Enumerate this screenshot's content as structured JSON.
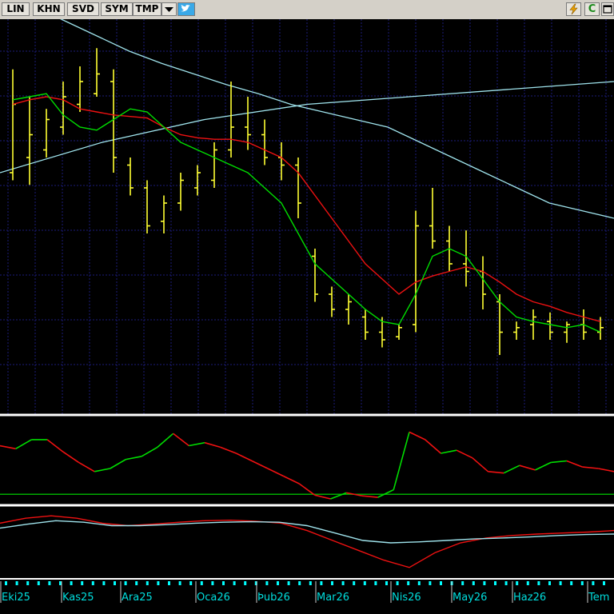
{
  "toolbar": {
    "buttons": [
      "LIN",
      "KHN",
      "SVD",
      "SYM",
      "TMP"
    ],
    "icons": [
      "dropdown-arrow-icon",
      "twitter-bird-icon",
      "lightning-icon",
      "refresh-c-icon",
      "maximize-icon"
    ],
    "refresh_label": "C"
  },
  "colors": {
    "background": "#000000",
    "grid": "#1b1b7a",
    "price_bar": "#ffff33",
    "ma_fast": "#00dd00",
    "ma_slow": "#ee1111",
    "ma_long": "#9fe3ec",
    "panel_border": "#ffffff",
    "level_line": "#00aa00",
    "axis_tick": "#00ffff",
    "axis_text": "#00dddd"
  },
  "chart_data": {
    "type": "line",
    "x_labels": [
      "Eki25",
      "Kas25",
      "Ara25",
      "Oca26",
      "Þub26",
      "Mar26",
      "Nis26",
      "May26",
      "Haz26",
      "Tem"
    ],
    "price_bars": [
      {
        "hi": 4.78,
        "lo": 4.05,
        "open": 4.1,
        "close": 4.55
      },
      {
        "hi": 4.6,
        "lo": 4.02,
        "open": 4.2,
        "close": 4.35
      },
      {
        "hi": 4.52,
        "lo": 4.2,
        "open": 4.25,
        "close": 4.45
      },
      {
        "hi": 4.7,
        "lo": 4.35,
        "open": 4.4,
        "close": 4.6
      },
      {
        "hi": 4.8,
        "lo": 4.5,
        "open": 4.55,
        "close": 4.7
      },
      {
        "hi": 4.92,
        "lo": 4.6,
        "open": 4.62,
        "close": 4.75
      },
      {
        "hi": 4.78,
        "lo": 4.1,
        "open": 4.7,
        "close": 4.2
      },
      {
        "hi": 4.2,
        "lo": 3.95,
        "open": 4.15,
        "close": 4.0
      },
      {
        "hi": 4.05,
        "lo": 3.7,
        "open": 4.0,
        "close": 3.75
      },
      {
        "hi": 3.95,
        "lo": 3.7,
        "open": 3.78,
        "close": 3.9
      },
      {
        "hi": 4.1,
        "lo": 3.85,
        "open": 3.9,
        "close": 4.05
      },
      {
        "hi": 4.15,
        "lo": 3.95,
        "open": 4.0,
        "close": 4.1
      },
      {
        "hi": 4.3,
        "lo": 4.0,
        "open": 4.05,
        "close": 4.25
      },
      {
        "hi": 4.7,
        "lo": 4.2,
        "open": 4.25,
        "close": 4.4
      },
      {
        "hi": 4.6,
        "lo": 4.25,
        "open": 4.4,
        "close": 4.35
      },
      {
        "hi": 4.45,
        "lo": 4.15,
        "open": 4.35,
        "close": 4.2
      },
      {
        "hi": 4.3,
        "lo": 4.05,
        "open": 4.2,
        "close": 4.15
      },
      {
        "hi": 4.2,
        "lo": 3.8,
        "open": 4.15,
        "close": 3.9
      },
      {
        "hi": 3.6,
        "lo": 3.25,
        "open": 3.55,
        "close": 3.3
      },
      {
        "hi": 3.35,
        "lo": 3.15,
        "open": 3.3,
        "close": 3.2
      },
      {
        "hi": 3.3,
        "lo": 3.1,
        "open": 3.2,
        "close": 3.25
      },
      {
        "hi": 3.2,
        "lo": 3.0,
        "open": 3.15,
        "close": 3.05
      },
      {
        "hi": 3.15,
        "lo": 2.95,
        "open": 3.05,
        "close": 3.0
      },
      {
        "hi": 3.1,
        "lo": 3.0,
        "open": 3.02,
        "close": 3.08
      },
      {
        "hi": 3.85,
        "lo": 3.05,
        "open": 3.1,
        "close": 3.75
      },
      {
        "hi": 4.0,
        "lo": 3.6,
        "open": 3.75,
        "close": 3.65
      },
      {
        "hi": 3.75,
        "lo": 3.45,
        "open": 3.65,
        "close": 3.5
      },
      {
        "hi": 3.72,
        "lo": 3.35,
        "open": 3.5,
        "close": 3.45
      },
      {
        "hi": 3.55,
        "lo": 3.2,
        "open": 3.45,
        "close": 3.3
      },
      {
        "hi": 3.3,
        "lo": 2.9,
        "open": 3.25,
        "close": 3.05
      },
      {
        "hi": 3.12,
        "lo": 3.0,
        "open": 3.05,
        "close": 3.08
      },
      {
        "hi": 3.2,
        "lo": 3.0,
        "open": 3.1,
        "close": 3.15
      },
      {
        "hi": 3.18,
        "lo": 3.0,
        "open": 3.12,
        "close": 3.05
      },
      {
        "hi": 3.12,
        "lo": 2.98,
        "open": 3.05,
        "close": 3.1
      },
      {
        "hi": 3.2,
        "lo": 3.0,
        "open": 3.1,
        "close": 3.05
      },
      {
        "hi": 3.15,
        "lo": 3.0,
        "open": 3.05,
        "close": 3.08
      }
    ],
    "series": [
      {
        "values": [
          4.58,
          4.6,
          4.62,
          4.48,
          4.4,
          4.38,
          4.45,
          4.52,
          4.5,
          4.4,
          4.3,
          4.25,
          4.2,
          4.15,
          4.1,
          4.0,
          3.9,
          3.7,
          3.5,
          3.4,
          3.3,
          3.2,
          3.12,
          3.1,
          3.3,
          3.55,
          3.6,
          3.55,
          3.4,
          3.25,
          3.15,
          3.12,
          3.1,
          3.08,
          3.1,
          3.05
        ]
      },
      {
        "values": [
          4.55,
          4.58,
          4.6,
          4.58,
          4.52,
          4.5,
          4.48,
          4.47,
          4.46,
          4.4,
          4.35,
          4.33,
          4.32,
          4.32,
          4.3,
          4.25,
          4.2,
          4.1,
          3.95,
          3.8,
          3.65,
          3.5,
          3.4,
          3.3,
          3.38,
          3.42,
          3.45,
          3.48,
          3.45,
          3.38,
          3.3,
          3.25,
          3.22,
          3.18,
          3.15,
          3.12
        ]
      },
      {
        "values": [
          5.3,
          5.2,
          5.1,
          5.0,
          4.9,
          4.82,
          4.75,
          4.68,
          4.62,
          4.55,
          4.5,
          4.45,
          4.4,
          4.3,
          4.2,
          4.1,
          4.0,
          3.9,
          3.85,
          3.8
        ]
      },
      {
        "values": [
          4.1,
          4.3,
          4.45,
          4.55,
          4.6,
          4.65,
          4.7
        ]
      }
    ],
    "oscillator": {
      "values": [
        70,
        66,
        78,
        78,
        62,
        48,
        36,
        40,
        52,
        56,
        68,
        86,
        70,
        74,
        68,
        60,
        50,
        40,
        30,
        20,
        5,
        0,
        8,
        4,
        2,
        12,
        88,
        78,
        60,
        64,
        54,
        36,
        34,
        44,
        38,
        48,
        50,
        42,
        40,
        36
      ],
      "level": 6
    },
    "macd": {
      "series": [
        {
          "values": [
            0.2,
            0.3,
            0.35,
            0.3,
            0.2,
            0.15,
            0.18,
            0.22,
            0.25,
            0.26,
            0.24,
            0.2,
            0.05,
            -0.15,
            -0.35,
            -0.55,
            -0.7,
            -0.4,
            -0.2,
            -0.1,
            -0.05,
            -0.02,
            0.0,
            0.02,
            0.05
          ]
        },
        {
          "values": [
            0.1,
            0.18,
            0.25,
            0.22,
            0.15,
            0.15,
            0.17,
            0.2,
            0.22,
            0.23,
            0.22,
            0.15,
            0.0,
            -0.15,
            -0.2,
            -0.18,
            -0.15,
            -0.12,
            -0.1,
            -0.08,
            -0.05,
            -0.03,
            -0.02
          ]
        }
      ]
    }
  }
}
